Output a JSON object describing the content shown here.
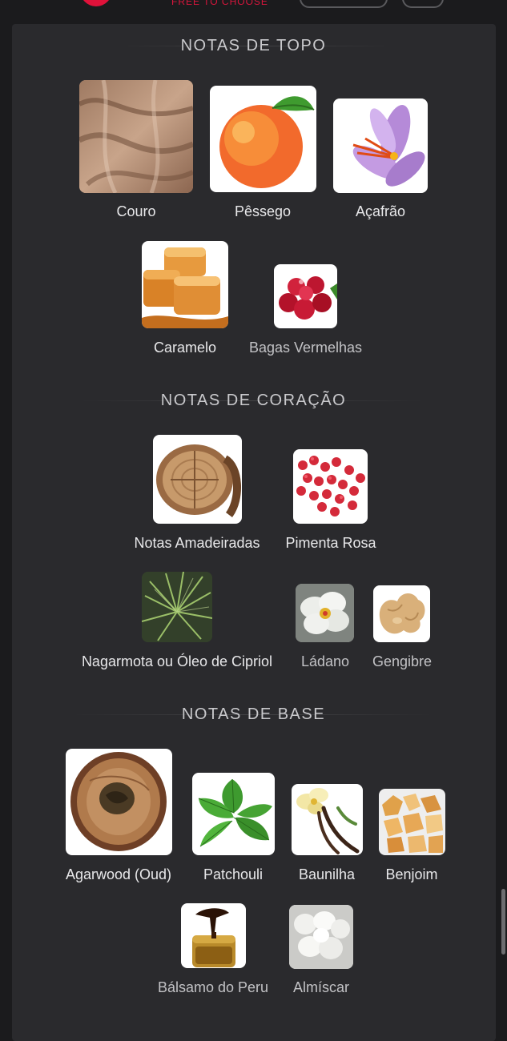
{
  "header": {
    "tagline": "FREE TO CHOOSE"
  },
  "sections": {
    "top": {
      "title": "NOTAS DE TOPO",
      "notes": [
        {
          "label": "Couro",
          "icon": "leather-icon"
        },
        {
          "label": "Pêssego",
          "icon": "peach-icon"
        },
        {
          "label": "Açafrão",
          "icon": "saffron-icon"
        },
        {
          "label": "Caramelo",
          "icon": "caramel-icon"
        },
        {
          "label": "Bagas Vermelhas",
          "icon": "red-berries-icon"
        }
      ]
    },
    "heart": {
      "title": "NOTAS DE CORAÇÃO",
      "notes": [
        {
          "label": "Notas Amadeiradas",
          "icon": "wood-icon"
        },
        {
          "label": "Pimenta Rosa",
          "icon": "pink-pepper-icon"
        },
        {
          "label": "Nagarmota ou Óleo de Cipriol",
          "icon": "nagarmota-icon"
        },
        {
          "label": "Ládano",
          "icon": "labdanum-icon"
        },
        {
          "label": "Gengibre",
          "icon": "ginger-icon"
        }
      ]
    },
    "base": {
      "title": "NOTAS DE BASE",
      "notes": [
        {
          "label": "Agarwood (Oud)",
          "icon": "agarwood-icon"
        },
        {
          "label": "Patchouli",
          "icon": "patchouli-icon"
        },
        {
          "label": "Baunilha",
          "icon": "vanilla-icon"
        },
        {
          "label": "Benjoim",
          "icon": "benzoin-icon"
        },
        {
          "label": "Bálsamo do Peru",
          "icon": "peru-balsam-icon"
        },
        {
          "label": "Almíscar",
          "icon": "musk-icon"
        }
      ]
    }
  },
  "colors": {
    "background": "#1b1b1d",
    "panel": "#2a2a2d",
    "brand_red": "#e0123a",
    "text": "#e8e8ea"
  }
}
